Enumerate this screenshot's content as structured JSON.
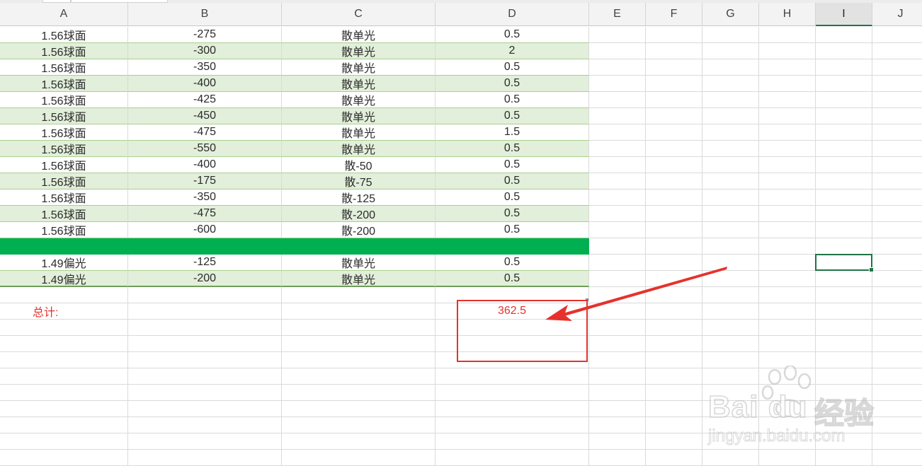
{
  "columns": [
    "A",
    "B",
    "C",
    "D",
    "E",
    "F",
    "G",
    "H",
    "I",
    "J"
  ],
  "selected_column": "I",
  "rows": [
    {
      "a": "1.56球面",
      "b": "-275",
      "c": "散单光",
      "d": "0.5",
      "style": "white"
    },
    {
      "a": "1.56球面",
      "b": "-300",
      "c": "散单光",
      "d": "2",
      "style": "green"
    },
    {
      "a": "1.56球面",
      "b": "-350",
      "c": "散单光",
      "d": "0.5",
      "style": "white"
    },
    {
      "a": "1.56球面",
      "b": "-400",
      "c": "散单光",
      "d": "0.5",
      "style": "green"
    },
    {
      "a": "1.56球面",
      "b": "-425",
      "c": "散单光",
      "d": "0.5",
      "style": "white"
    },
    {
      "a": "1.56球面",
      "b": "-450",
      "c": "散单光",
      "d": "0.5",
      "style": "green"
    },
    {
      "a": "1.56球面",
      "b": "-475",
      "c": "散单光",
      "d": "1.5",
      "style": "white"
    },
    {
      "a": "1.56球面",
      "b": "-550",
      "c": "散单光",
      "d": "0.5",
      "style": "green"
    },
    {
      "a": "1.56球面",
      "b": "-400",
      "c": "散-50",
      "d": "0.5",
      "style": "white"
    },
    {
      "a": "1.56球面",
      "b": "-175",
      "c": "散-75",
      "d": "0.5",
      "style": "green"
    },
    {
      "a": "1.56球面",
      "b": "-350",
      "c": "散-125",
      "d": "0.5",
      "style": "white"
    },
    {
      "a": "1.56球面",
      "b": "-475",
      "c": "散-200",
      "d": "0.5",
      "style": "green"
    },
    {
      "a": "1.56球面",
      "b": "-600",
      "c": "散-200",
      "d": "0.5",
      "style": "white"
    },
    {
      "a": "",
      "b": "",
      "c": "",
      "d": "",
      "style": "bar"
    },
    {
      "a": "1.49偏光",
      "b": "-125",
      "c": "散单光",
      "d": "0.5",
      "style": "white"
    },
    {
      "a": "1.49偏光",
      "b": "-200",
      "c": "散单光",
      "d": "0.5",
      "style": "green"
    }
  ],
  "total": {
    "label": "总计:",
    "value": "362.5"
  },
  "colors": {
    "green_band": "#e2efda",
    "highlight_bar": "#00b050",
    "annotation_red": "#e5322d",
    "selection": "#217346"
  },
  "watermark": {
    "logo": "Bai du",
    "brand_cn": "经验",
    "url": "jingyan.baidu.com"
  }
}
